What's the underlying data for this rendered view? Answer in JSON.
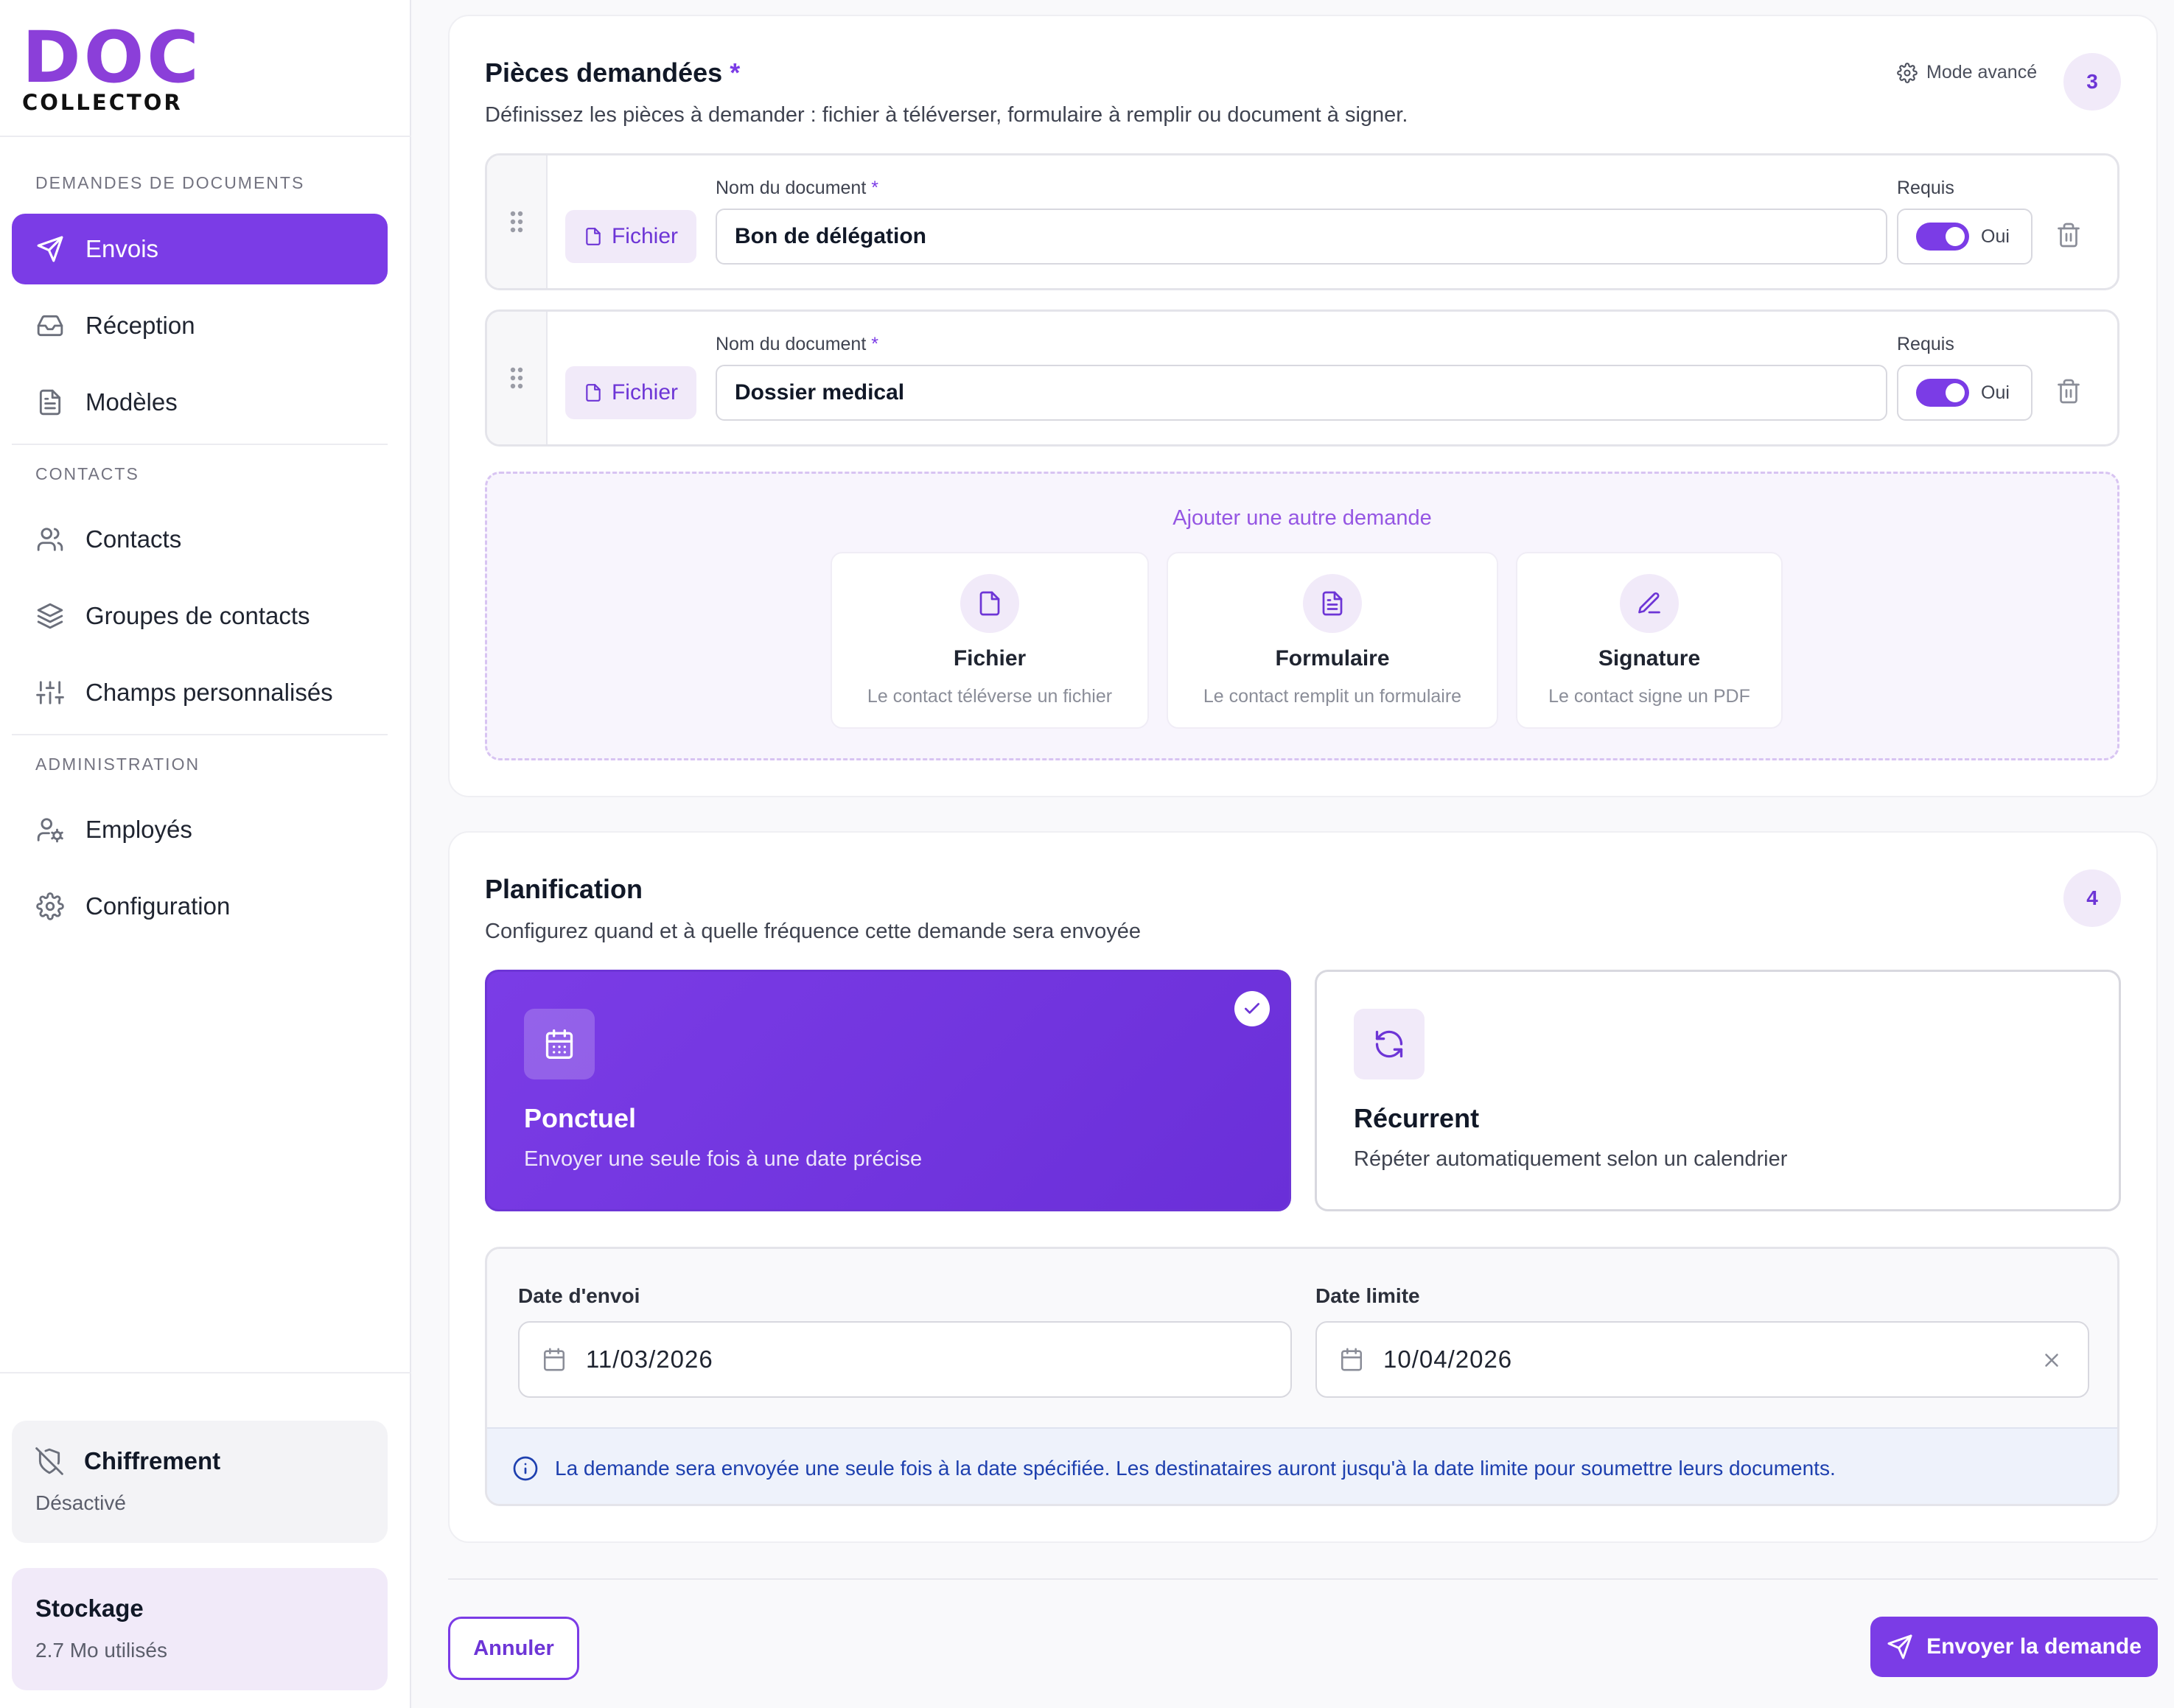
{
  "brand": {
    "logo_main": "DOC",
    "logo_sub": "COLLECTOR"
  },
  "sidebar": {
    "sections": [
      {
        "heading": "DEMANDES DE DOCUMENTS",
        "items": [
          {
            "label": "Envois",
            "icon": "send-icon",
            "active": true
          },
          {
            "label": "Réception",
            "icon": "inbox-icon"
          },
          {
            "label": "Modèles",
            "icon": "document-icon"
          }
        ]
      },
      {
        "heading": "CONTACTS",
        "items": [
          {
            "label": "Contacts",
            "icon": "users-icon"
          },
          {
            "label": "Groupes de contacts",
            "icon": "layers-icon"
          },
          {
            "label": "Champs personnalisés",
            "icon": "sliders-icon"
          }
        ]
      },
      {
        "heading": "ADMINISTRATION",
        "items": [
          {
            "label": "Employés",
            "icon": "user-cog-icon"
          },
          {
            "label": "Configuration",
            "icon": "gear-icon"
          }
        ]
      }
    ],
    "encryption": {
      "title": "Chiffrement",
      "status": "Désactivé"
    },
    "storage": {
      "title": "Stockage",
      "usage": "2.7 Mo utilisés"
    }
  },
  "pieces": {
    "title": "Pièces demandées",
    "required_mark": "*",
    "description": "Définissez les pièces à demander : fichier à téléverser, formulaire à remplir ou document à signer.",
    "advanced_mode": "Mode avancé",
    "step": "3",
    "name_label": "Nom du document",
    "required_label": "Requis",
    "documents": [
      {
        "type": "Fichier",
        "name": "Bon de délégation",
        "required_text": "Oui",
        "required": true
      },
      {
        "type": "Fichier",
        "name": "Dossier medical",
        "required_text": "Oui",
        "required": true
      }
    ],
    "add_title": "Ajouter une autre demande",
    "add_options": [
      {
        "title": "Fichier",
        "subtitle": "Le contact téléverse un fichier",
        "icon": "file-icon"
      },
      {
        "title": "Formulaire",
        "subtitle": "Le contact remplit un formulaire",
        "icon": "form-icon"
      },
      {
        "title": "Signature",
        "subtitle": "Le contact signe un PDF",
        "icon": "pen-icon"
      }
    ]
  },
  "planning": {
    "title": "Planification",
    "description": "Configurez quand et à quelle fréquence cette demande sera envoyée",
    "step": "4",
    "options": [
      {
        "title": "Ponctuel",
        "subtitle": "Envoyer une seule fois à une date précise",
        "selected": true,
        "icon": "calendar-icon"
      },
      {
        "title": "Récurrent",
        "subtitle": "Répéter automatiquement selon un calendrier",
        "selected": false,
        "icon": "refresh-icon"
      }
    ],
    "send_date_label": "Date d'envoi",
    "send_date": "11/03/2026",
    "deadline_label": "Date limite",
    "deadline": "10/04/2026",
    "info": "La demande sera envoyée une seule fois à la date spécifiée. Les destinataires auront jusqu'à la date limite pour soumettre leurs documents."
  },
  "footer": {
    "cancel": "Annuler",
    "submit": "Envoyer la demande"
  },
  "colors": {
    "accent": "#7b3ce6",
    "accent_soft": "#f1eaf9",
    "info_text": "#1e40af"
  }
}
